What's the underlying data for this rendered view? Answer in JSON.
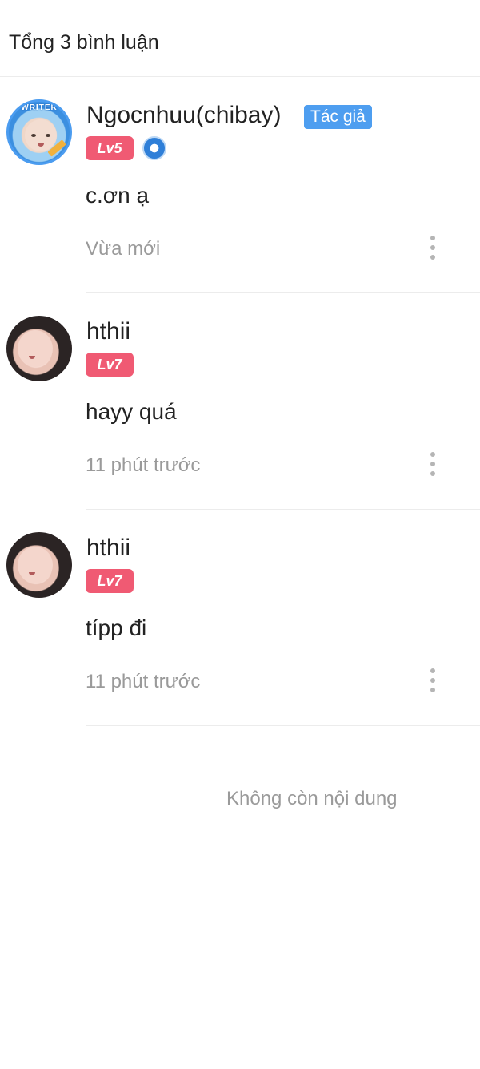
{
  "header": {
    "title": "Tổng 3 bình luận"
  },
  "comments": [
    {
      "username": "Ngocnhuu(chibay)",
      "author_tag": "Tác giả",
      "level": "Lv5",
      "avatar_label": "WRITER",
      "text": "c.ơn ạ",
      "time": "Vừa mới"
    },
    {
      "username": "hthii",
      "level": "Lv7",
      "text": "hayy quá",
      "time": "11 phút trước"
    },
    {
      "username": "hthii",
      "level": "Lv7",
      "text": "típp đi",
      "time": "11 phút trước"
    }
  ],
  "footer": {
    "empty_text": "Không còn nội dung"
  },
  "colors": {
    "level_badge": "#f05a73",
    "author_tag": "#4e9ef0",
    "muted_text": "#9a9a9a"
  },
  "icons": {
    "more": "more-vertical-icon",
    "writer": "pen-nib-icon"
  }
}
